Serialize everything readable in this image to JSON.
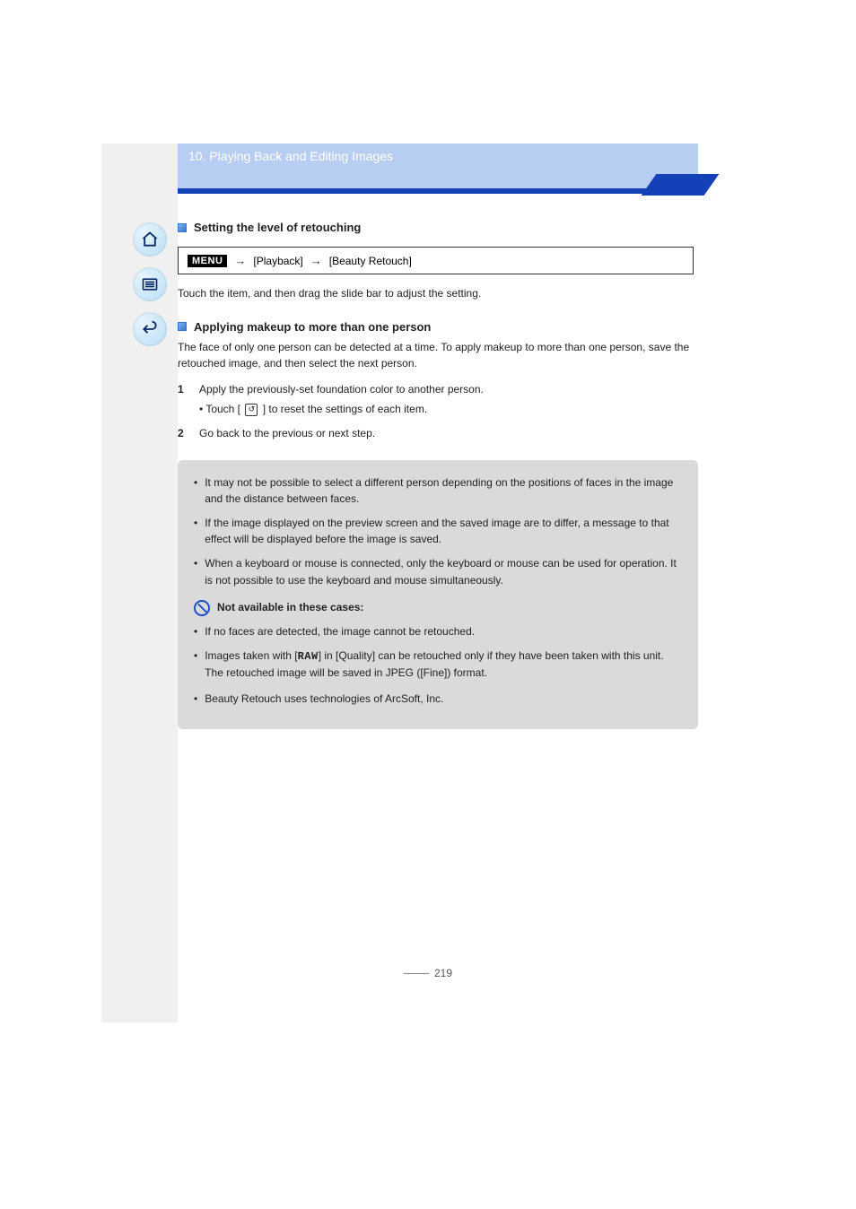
{
  "sidebar": {
    "icons": {
      "home": "home-icon",
      "menu": "menu-icon",
      "back": "back-icon"
    }
  },
  "banner": {
    "category": "10. Playing Back and Editing Images"
  },
  "section1": {
    "heading": "Setting the level of retouching",
    "menu": {
      "label": "MENU",
      "path1": "[Playback]",
      "path2": "[Beauty Retouch]"
    },
    "note": "Touch the item, and then drag the slide bar to adjust the setting."
  },
  "section2": {
    "heading": "Applying makeup to more than one person",
    "intro": "The face of only one person can be detected at a time. To apply makeup to more than one person, save the retouched image, and then select the next person.",
    "steps": [
      {
        "n": "1",
        "text": "Apply the previously-set foundation color to another person.",
        "sub_a": "Touch [",
        "sub_icon": "reset-icon",
        "sub_b": "] to reset the settings of each item."
      },
      {
        "n": "2",
        "text": "Go back to the previous or next step."
      }
    ]
  },
  "infobox": {
    "b1": "It may not be possible to select a different person depending on the positions of faces in the image and the distance between faces.",
    "b2": "If the image displayed on the preview screen and the saved image are to differ, a message to that effect will be displayed before the image is saved.",
    "b3": "When a keyboard or mouse is connected, only the keyboard or mouse can be used for operation. It is not possible to use the keyboard and mouse simultaneously.",
    "not_available_label": "Not available in these cases:",
    "na1": "If no faces are detected, the image cannot be retouched.",
    "na2_a": "Images taken with [",
    "na2_raw": "RAW",
    "na2_b": "] in [Quality] can be retouched only if they have been taken with this unit. The retouched image will be saved in JPEG ([Fine]) format.",
    "trademark": "Beauty Retouch uses technologies of ArcSoft, Inc."
  },
  "pagenum": "219"
}
